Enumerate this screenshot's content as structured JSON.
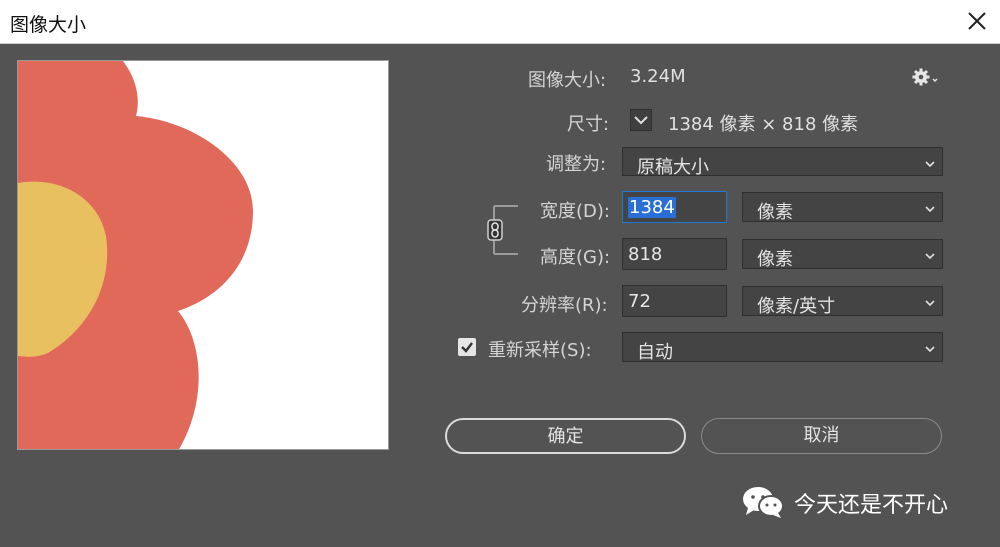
{
  "window": {
    "title": "图像大小"
  },
  "info": {
    "size_label": "图像大小:",
    "size_value": "3.24M",
    "dim_label": "尺寸:",
    "dim_value": "1384 像素  ×  818 像素"
  },
  "fit": {
    "label": "调整为:",
    "value": "原稿大小"
  },
  "width": {
    "label": "宽度(D):",
    "value": "1384",
    "unit": "像素"
  },
  "height": {
    "label": "高度(G):",
    "value": "818",
    "unit": "像素"
  },
  "resolution": {
    "label": "分辨率(R):",
    "value": "72",
    "unit": "像素/英寸"
  },
  "resample": {
    "label": "重新采样(S):",
    "checked": true,
    "value": "自动"
  },
  "buttons": {
    "ok": "确定",
    "cancel": "取消"
  },
  "watermark": {
    "text": "今天还是不开心",
    "icon": "wechat-icon"
  },
  "colors": {
    "background": "#535353",
    "petal": "#e0695a",
    "center": "#e9c060",
    "focus": "#1e78d6"
  }
}
